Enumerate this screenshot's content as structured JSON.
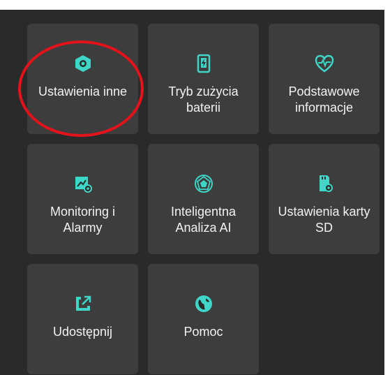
{
  "menu": {
    "tiles": [
      {
        "label": "Ustawienia inne",
        "icon": "settings-hexagon-icon"
      },
      {
        "label": "Tryb zużycia baterii",
        "icon": "battery-mode-icon"
      },
      {
        "label": "Podstawowe informacje",
        "icon": "heart-pulse-icon"
      },
      {
        "label": "Monitoring i Alarmy",
        "icon": "monitor-camera-icon"
      },
      {
        "label": "Inteligentna Analiza AI",
        "icon": "ai-polygon-icon"
      },
      {
        "label": "Ustawienia karty SD",
        "icon": "sd-card-icon"
      },
      {
        "label": "Udostępnij",
        "icon": "share-arrow-icon"
      },
      {
        "label": "Pomoc",
        "icon": "help-globe-icon"
      }
    ]
  },
  "colors": {
    "accent": "#3fd6c8",
    "tile_bg": "#3d3d3d",
    "page_bg": "#2a2a2a",
    "highlight": "#e3121b"
  }
}
